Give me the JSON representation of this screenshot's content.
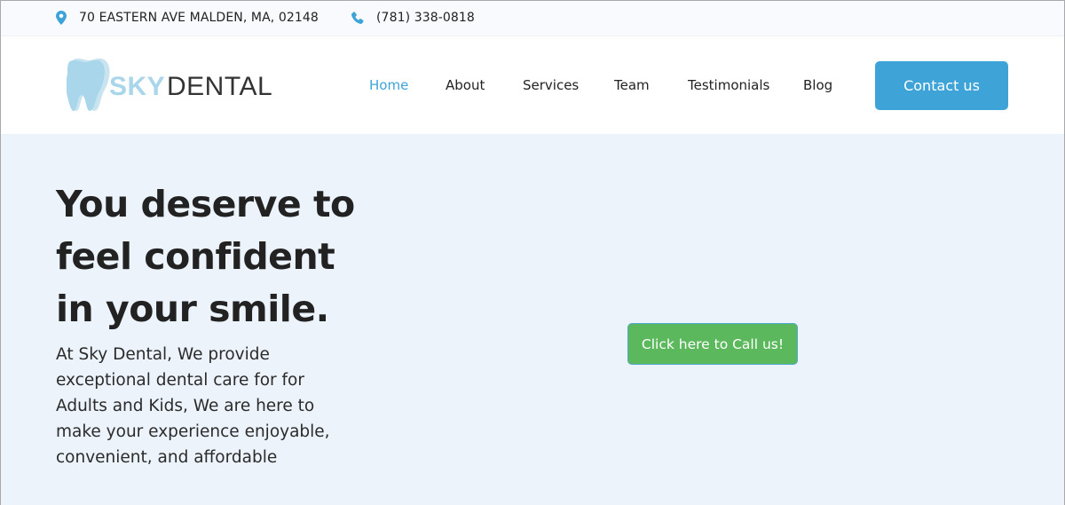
{
  "topbar": {
    "address_icon": "map-pin-icon",
    "address": "70 EASTERN AVE MALDEN, MA, 02148",
    "phone_icon": "phone-icon",
    "phone": "(781) 338-0818"
  },
  "header": {
    "logo": {
      "icon": "tooth-icon",
      "brand_primary": "SKY",
      "brand_secondary": "DENTAL"
    },
    "nav": [
      {
        "label": "Home",
        "active": true
      },
      {
        "label": "About",
        "active": false
      },
      {
        "label": "Services",
        "active": false
      },
      {
        "label": "Team",
        "active": false
      },
      {
        "label": "Testimonials",
        "active": false
      },
      {
        "label": "Blog",
        "active": false
      }
    ],
    "contact_label": "Contact us"
  },
  "hero": {
    "headline": "You deserve to feel confident in your smile.",
    "description": "At Sky Dental, We provide exceptional dental care for for Adults and Kids, We are here to make your experience enjoyable, convenient, and affordable",
    "call_label": "Click here to Call us!"
  },
  "colors": {
    "accent": "#3ea4d8",
    "call_button": "#5cb85c",
    "hero_bg": "#ecf3fb",
    "topbar_bg": "#f8fafd",
    "logo_light": "#a9d6ea"
  }
}
